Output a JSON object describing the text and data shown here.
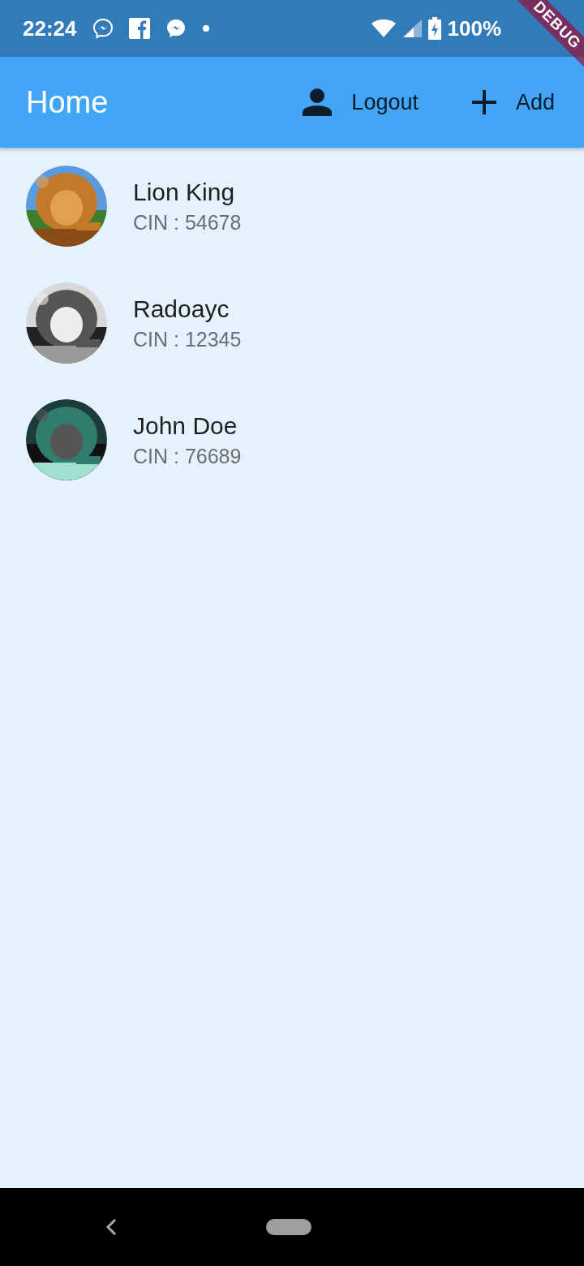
{
  "status_bar": {
    "time": "22:24",
    "battery": "100%"
  },
  "debug_banner": {
    "label": "DEBUG"
  },
  "app_bar": {
    "title": "Home",
    "actions": [
      {
        "kind": "logout",
        "label": "Logout"
      },
      {
        "kind": "add",
        "label": "Add"
      }
    ]
  },
  "people": [
    {
      "name": "Lion King",
      "cin": "CIN : 54678"
    },
    {
      "name": "Radoayc",
      "cin": "CIN : 12345"
    },
    {
      "name": "John Doe",
      "cin": "CIN : 76689"
    }
  ]
}
